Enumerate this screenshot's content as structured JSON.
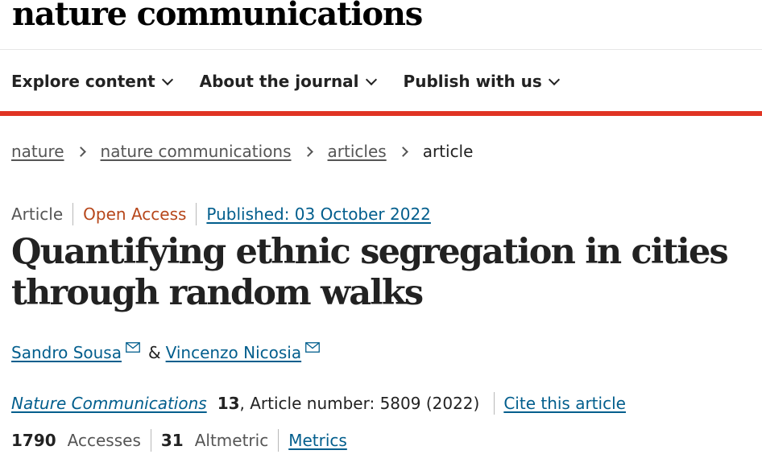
{
  "site": {
    "logo": "nature communications"
  },
  "nav": {
    "items": [
      {
        "label": "Explore content"
      },
      {
        "label": "About the journal"
      },
      {
        "label": "Publish with us"
      }
    ]
  },
  "breadcrumb": {
    "items": [
      "nature",
      "nature communications",
      "articles"
    ],
    "current": "article"
  },
  "article": {
    "type": "Article",
    "access": "Open Access",
    "published": "Published: 03 October 2022",
    "title": "Quantifying ethnic segregation in cities through random walks",
    "authors": [
      {
        "name": "Sandro Sousa"
      },
      {
        "name": "Vincenzo Nicosia"
      }
    ],
    "author_separator": "&",
    "journal": {
      "name": "Nature Communications",
      "volume": "13",
      "details": ", Article number: 5809 (2022)",
      "cite_label": "Cite this article"
    },
    "metrics": {
      "accesses_value": "1790",
      "accesses_label": "Accesses",
      "altmetric_value": "31",
      "altmetric_label": "Altmetric",
      "metrics_link": "Metrics"
    }
  },
  "colors": {
    "accent_bar": "#e03423",
    "link": "#025e8d",
    "open_access": "#b7471b"
  },
  "icons": [
    "chevron-down-icon",
    "chevron-right-icon",
    "mail-icon"
  ]
}
